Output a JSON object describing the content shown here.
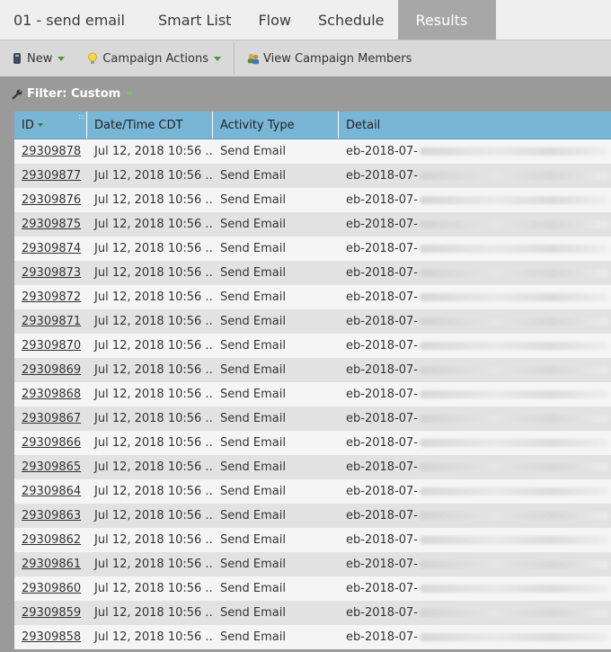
{
  "tabs": [
    {
      "label": "01 - send email",
      "active": false
    },
    {
      "label": "Smart List",
      "active": false
    },
    {
      "label": "Flow",
      "active": false
    },
    {
      "label": "Schedule",
      "active": false
    },
    {
      "label": "Results",
      "active": true
    }
  ],
  "toolbar": {
    "new_label": "New",
    "campaign_actions_label": "Campaign Actions",
    "view_members_label": "View Campaign Members"
  },
  "filter": {
    "label": "Filter: Custom"
  },
  "table": {
    "columns": [
      "ID",
      "Date/Time CDT",
      "Activity Type",
      "Detail"
    ],
    "rows": [
      {
        "id": "29309878",
        "datetime": "Jul 12, 2018 10:56 ...",
        "activity": "Send Email",
        "detail": "eb-2018-07-"
      },
      {
        "id": "29309877",
        "datetime": "Jul 12, 2018 10:56 ...",
        "activity": "Send Email",
        "detail": "eb-2018-07-"
      },
      {
        "id": "29309876",
        "datetime": "Jul 12, 2018 10:56 ...",
        "activity": "Send Email",
        "detail": "eb-2018-07-"
      },
      {
        "id": "29309875",
        "datetime": "Jul 12, 2018 10:56 ...",
        "activity": "Send Email",
        "detail": "eb-2018-07-"
      },
      {
        "id": "29309874",
        "datetime": "Jul 12, 2018 10:56 ...",
        "activity": "Send Email",
        "detail": "eb-2018-07-"
      },
      {
        "id": "29309873",
        "datetime": "Jul 12, 2018 10:56 ...",
        "activity": "Send Email",
        "detail": "eb-2018-07-"
      },
      {
        "id": "29309872",
        "datetime": "Jul 12, 2018 10:56 ...",
        "activity": "Send Email",
        "detail": "eb-2018-07-"
      },
      {
        "id": "29309871",
        "datetime": "Jul 12, 2018 10:56 ...",
        "activity": "Send Email",
        "detail": "eb-2018-07-"
      },
      {
        "id": "29309870",
        "datetime": "Jul 12, 2018 10:56 ...",
        "activity": "Send Email",
        "detail": "eb-2018-07-"
      },
      {
        "id": "29309869",
        "datetime": "Jul 12, 2018 10:56 ...",
        "activity": "Send Email",
        "detail": "eb-2018-07-"
      },
      {
        "id": "29309868",
        "datetime": "Jul 12, 2018 10:56 ...",
        "activity": "Send Email",
        "detail": "eb-2018-07-"
      },
      {
        "id": "29309867",
        "datetime": "Jul 12, 2018 10:56 ...",
        "activity": "Send Email",
        "detail": "eb-2018-07-"
      },
      {
        "id": "29309866",
        "datetime": "Jul 12, 2018 10:56 ...",
        "activity": "Send Email",
        "detail": "eb-2018-07-"
      },
      {
        "id": "29309865",
        "datetime": "Jul 12, 2018 10:56 ...",
        "activity": "Send Email",
        "detail": "eb-2018-07-"
      },
      {
        "id": "29309864",
        "datetime": "Jul 12, 2018 10:56 ...",
        "activity": "Send Email",
        "detail": "eb-2018-07-"
      },
      {
        "id": "29309863",
        "datetime": "Jul 12, 2018 10:56 ...",
        "activity": "Send Email",
        "detail": "eb-2018-07-"
      },
      {
        "id": "29309862",
        "datetime": "Jul 12, 2018 10:56 ...",
        "activity": "Send Email",
        "detail": "eb-2018-07-"
      },
      {
        "id": "29309861",
        "datetime": "Jul 12, 2018 10:56 ...",
        "activity": "Send Email",
        "detail": "eb-2018-07-"
      },
      {
        "id": "29309860",
        "datetime": "Jul 12, 2018 10:56 ...",
        "activity": "Send Email",
        "detail": "eb-2018-07-"
      },
      {
        "id": "29309859",
        "datetime": "Jul 12, 2018 10:56 ...",
        "activity": "Send Email",
        "detail": "eb-2018-07-"
      },
      {
        "id": "29309858",
        "datetime": "Jul 12, 2018 10:56 ...",
        "activity": "Send Email",
        "detail": "eb-2018-07-"
      }
    ]
  },
  "icons": {
    "new": "new-icon",
    "campaign_actions": "lightbulb-icon",
    "view_members": "people-icon",
    "filter": "wrench-icon"
  },
  "colors": {
    "header_bg": "#79b6d6",
    "active_tab": "#a7a7a7",
    "caret": "#4a9b3a"
  }
}
